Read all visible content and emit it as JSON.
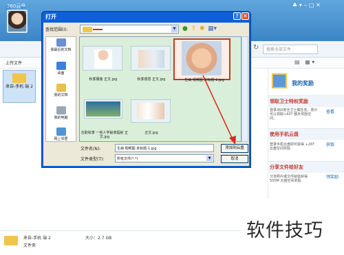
{
  "app": {
    "title": "360云盘",
    "search_placeholder": "搜索全部文件",
    "upload_label": "上传文件",
    "folder_tile_label": "来自-手机 端 2",
    "window_controls": "♣ ▾ ‒ □ ✕"
  },
  "sidebar": {
    "rewards_title": "我的奖励",
    "sections": [
      {
        "title": "领取卫士特权奖励",
        "desc": "登录360安全卫士做任务，累计可以领取+43T 额外奖励空间。",
        "link": "查看"
      },
      {
        "title": "使用手机云盘",
        "desc": "登录手机云盘即可获得 +26T 云盘空间奖励",
        "link": "获取"
      },
      {
        "title": "分享文件给好友",
        "desc": "分享照片或文件就能获得 500M 云盘空间奖励",
        "link": "领奖励"
      }
    ]
  },
  "bottom_info": {
    "name": "来自-手机 端 2",
    "size": "大小：2.7 GB",
    "type": "文件夹"
  },
  "watermark": "软件技巧",
  "dialog": {
    "title": "打开",
    "look_in_label": "查找范围(I):",
    "places": [
      "我最近的文档",
      "桌面",
      "我的文档",
      "我的电脑",
      "网上邻居"
    ],
    "files": [
      {
        "name": "秋季服装 正文.jpg"
      },
      {
        "name": "秋季感冒 正文.jpg"
      },
      {
        "name": "生病 咽喉图 未标题-1.jpg"
      },
      {
        "name": "在职秋季 一些人学秘收辐射 正文.jpg"
      },
      {
        "name": "正文.jpg"
      }
    ],
    "file_name_label": "文件名(N):",
    "file_name_value": "生病 咽喉图 未标题-1.jpg",
    "file_type_label": "文件类型(T):",
    "file_type_value": "所有文件(*.*)",
    "add_button": "添加到云盘",
    "cancel_button": "取消"
  }
}
